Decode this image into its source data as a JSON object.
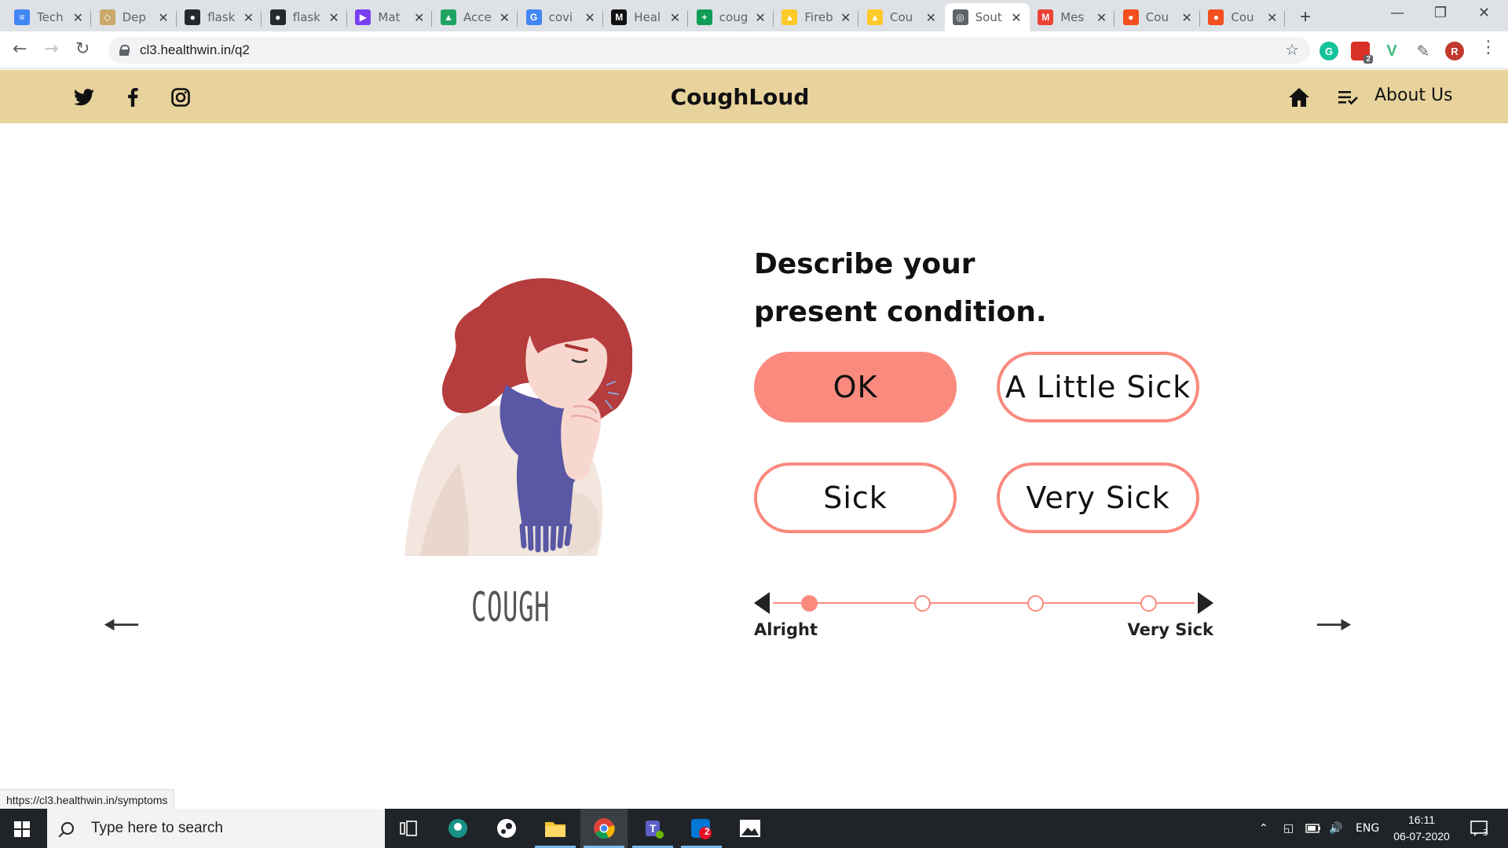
{
  "browser": {
    "tabs": [
      {
        "title": "Tech",
        "icon": "google-docs-icon",
        "color": "#4285f4"
      },
      {
        "title": "Dep",
        "icon": "deploy-icon",
        "color": "#c9a86a"
      },
      {
        "title": "flask",
        "icon": "github-icon",
        "color": "#24292e"
      },
      {
        "title": "flask",
        "icon": "github-icon",
        "color": "#24292e"
      },
      {
        "title": "Mat",
        "icon": "play-icon",
        "color": "#7b3ff2"
      },
      {
        "title": "Acce",
        "icon": "google-drive-icon",
        "color": "#1fa463"
      },
      {
        "title": "covi",
        "icon": "google-icon",
        "color": "#4285f4"
      },
      {
        "title": "Heal",
        "icon": "medium-icon",
        "color": "#111111"
      },
      {
        "title": "coug",
        "icon": "google-sheets-icon",
        "color": "#0f9d58"
      },
      {
        "title": "Fireb",
        "icon": "firebase-icon",
        "color": "#ffca28"
      },
      {
        "title": "Cou",
        "icon": "firebase-icon",
        "color": "#ffca28"
      },
      {
        "title": "Sout",
        "icon": "globe-icon",
        "color": "#5f6368"
      },
      {
        "title": "Mes",
        "icon": "gmail-icon",
        "color": "#ea4335"
      },
      {
        "title": "Cou",
        "icon": "figma-icon",
        "color": "#f24e1e"
      },
      {
        "title": "Cou",
        "icon": "figma-icon",
        "color": "#f24e1e"
      }
    ],
    "active_tab": 11,
    "url": "cl3.healthwin.in/q2",
    "profile_initial": "R",
    "extension_badge": "2",
    "status_url": "https://cl3.healthwin.in/symptoms"
  },
  "site": {
    "brand": "CoughLoud",
    "nav_about": "About Us",
    "header_color": "#e8d39d",
    "accent": "#fa8a7e"
  },
  "main": {
    "illustration_label": "COUGH",
    "question": "Describe your present condition.",
    "options": [
      "OK",
      "A Little Sick",
      "Sick",
      "Very Sick"
    ],
    "selected_option": 0,
    "scale": {
      "left_label": "Alright",
      "right_label": "Very Sick",
      "steps": 5,
      "selected_step": 0
    }
  },
  "taskbar": {
    "search_placeholder": "Type here to search",
    "language": "ENG",
    "time": "16:11",
    "date": "06-07-2020",
    "notifications": "3",
    "skype_badge": "2"
  }
}
